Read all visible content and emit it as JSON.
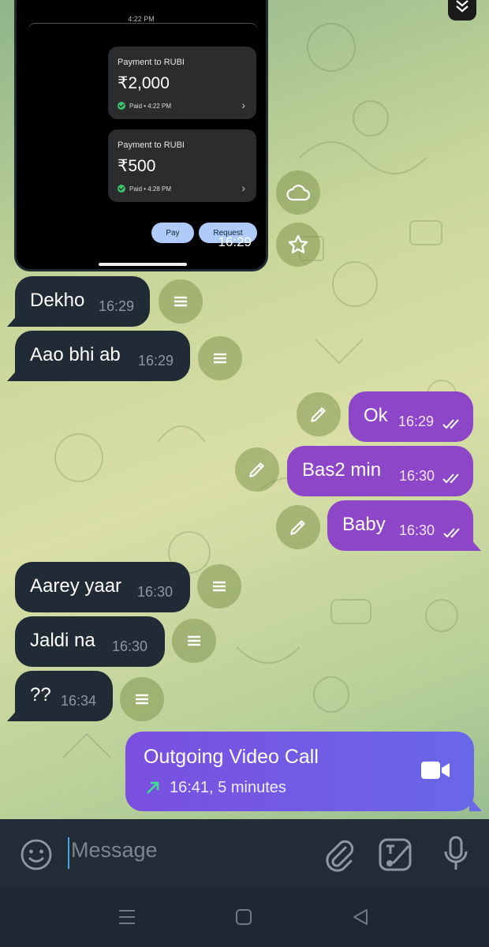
{
  "screenshot": {
    "divider_time": "4:22 PM",
    "payments": [
      {
        "title": "Payment to RUBI",
        "amount": "₹2,000",
        "status": "Paid • 4:22 PM"
      },
      {
        "title": "Payment to RUBI",
        "amount": "₹500",
        "status": "Paid • 4:28 PM"
      }
    ],
    "pay_label": "Pay",
    "request_label": "Request",
    "time": "16:29"
  },
  "messages": [
    {
      "dir": "in",
      "text": "Dekho",
      "time": "16:29"
    },
    {
      "dir": "in",
      "text": "Aao bhi ab",
      "time": "16:29"
    },
    {
      "dir": "out",
      "text": "Ok",
      "time": "16:29"
    },
    {
      "dir": "out",
      "text": "Bas2 min",
      "time": "16:30"
    },
    {
      "dir": "out",
      "text": "Baby",
      "time": "16:30"
    },
    {
      "dir": "in",
      "text": "Aarey yaar",
      "time": "16:30"
    },
    {
      "dir": "in",
      "text": "Jaldi na",
      "time": "16:30"
    },
    {
      "dir": "in",
      "text": "??",
      "time": "16:34"
    }
  ],
  "call": {
    "title": "Outgoing Video Call",
    "detail": "16:41, 5 minutes"
  },
  "composer": {
    "placeholder": "Message"
  },
  "colors": {
    "incoming_bubble": "#212b35",
    "outgoing_bubble": "#8e46c8",
    "call_bubble": "#6a67e8",
    "input_bar": "#222c36"
  },
  "icons": [
    "cloud-icon",
    "star-icon",
    "menu-icon",
    "pencil-icon",
    "double-check-icon",
    "video-camera-icon",
    "arrow-up-right-icon",
    "emoji-icon",
    "paperclip-icon",
    "sticker-icon",
    "microphone-icon",
    "chevrons-down-icon",
    "menu-nav-icon",
    "square-nav-icon",
    "back-nav-icon"
  ]
}
